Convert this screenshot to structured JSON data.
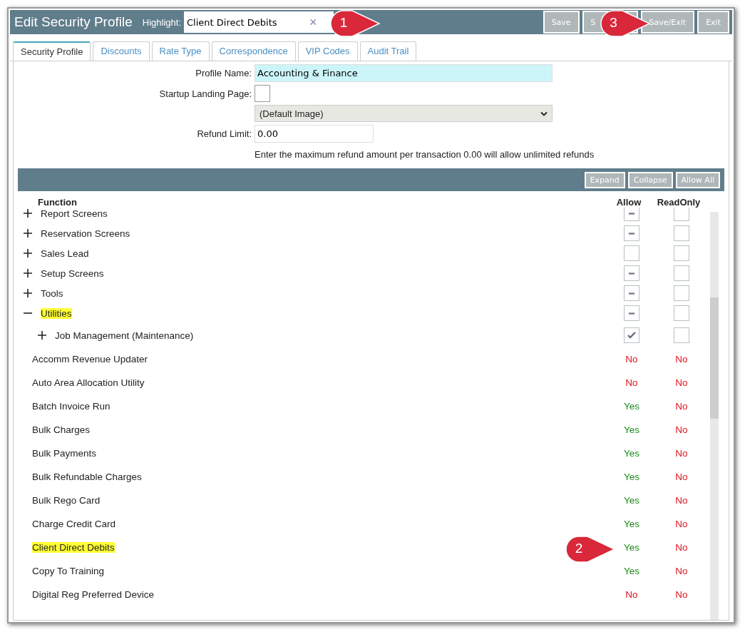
{
  "window": {
    "title": "Edit Security Profile"
  },
  "highlight": {
    "label": "Highlight:",
    "value": "Client Direct Debits",
    "clear": "×",
    "callout": "1"
  },
  "buttons": [
    {
      "label": "Save"
    },
    {
      "label": "S",
      "callout": "3"
    },
    {
      "label": "Save/Exit"
    },
    {
      "label": "Exit"
    }
  ],
  "tabs": [
    {
      "label": "Security Profile",
      "selected": true
    },
    {
      "label": "Discounts",
      "selected": false
    },
    {
      "label": "Rate Type",
      "selected": false
    },
    {
      "label": "Correspondence",
      "selected": false
    },
    {
      "label": "VIP Codes",
      "selected": false
    },
    {
      "label": "Audit Trail",
      "selected": false
    }
  ],
  "form": {
    "profile_name": {
      "label": "Profile Name:",
      "value": "Accounting & Finance"
    },
    "startup_landing_page": {
      "label": "Startup Landing Page:",
      "checked": false,
      "select": "(Default Image)"
    },
    "refund_limit": {
      "label": "Refund Limit:",
      "value": "0.00",
      "hint": "Enter the maximum refund amount per transaction 0.00 will allow unlimited refunds"
    }
  },
  "toolbar": [
    "Expand",
    "Collapse",
    "Allow All"
  ],
  "columns": [
    "Function",
    "Allow",
    "ReadOnly"
  ],
  "tree": [
    {
      "label": "Report Screens",
      "expanded": false,
      "highlighted": false,
      "allow_partial": true,
      "readonly": false
    },
    {
      "label": "Reservation Screens",
      "expanded": false,
      "highlighted": false,
      "allow_partial": true,
      "readonly": false
    },
    {
      "label": "Sales Lead",
      "expanded": false,
      "highlighted": false,
      "allow_checked": false,
      "readonly": false
    },
    {
      "label": "Setup Screens",
      "expanded": false,
      "highlighted": false,
      "allow_partial": true,
      "readonly": false
    },
    {
      "label": "Tools",
      "expanded": false,
      "highlighted": false,
      "allow_partial": true,
      "readonly": false
    },
    {
      "label": "Utilities",
      "expanded": true,
      "highlighted": true,
      "allow_partial": true,
      "readonly": false,
      "children": [
        {
          "label": "Job Management (Maintenance)",
          "expanded": false,
          "highlighted": false,
          "allow_checked": true,
          "readonly": false
        }
      ]
    }
  ],
  "functions": [
    {
      "label": "Accomm Revenue Updater",
      "highlighted": false,
      "allow": "No",
      "allowed": false,
      "readonly": "No"
    },
    {
      "label": "Auto Area Allocation Utility",
      "highlighted": false,
      "allow": "No",
      "allowed": false,
      "readonly": "No"
    },
    {
      "label": "Batch Invoice Run",
      "highlighted": false,
      "allow": "Yes",
      "allowed": true,
      "readonly": "No"
    },
    {
      "label": "Bulk Charges",
      "highlighted": false,
      "allow": "Yes",
      "allowed": true,
      "readonly": "No"
    },
    {
      "label": "Bulk Payments",
      "highlighted": false,
      "allow": "Yes",
      "allowed": true,
      "readonly": "No"
    },
    {
      "label": "Bulk Refundable Charges",
      "highlighted": false,
      "allow": "Yes",
      "allowed": true,
      "readonly": "No"
    },
    {
      "label": "Bulk Rego Card",
      "highlighted": false,
      "allow": "Yes",
      "allowed": true,
      "readonly": "No"
    },
    {
      "label": "Charge Credit Card",
      "highlighted": false,
      "allow": "Yes",
      "allowed": true,
      "readonly": "No"
    },
    {
      "label": "Client Direct Debits",
      "highlighted": true,
      "allow": "Yes",
      "allowed": true,
      "readonly": "No",
      "callout": "2"
    },
    {
      "label": "Copy To Training",
      "highlighted": false,
      "allow": "Yes",
      "allowed": true,
      "readonly": "No"
    },
    {
      "label": "Digital Reg Preferred Device",
      "highlighted": false,
      "allow": "No",
      "allowed": false,
      "readonly": "No"
    }
  ]
}
